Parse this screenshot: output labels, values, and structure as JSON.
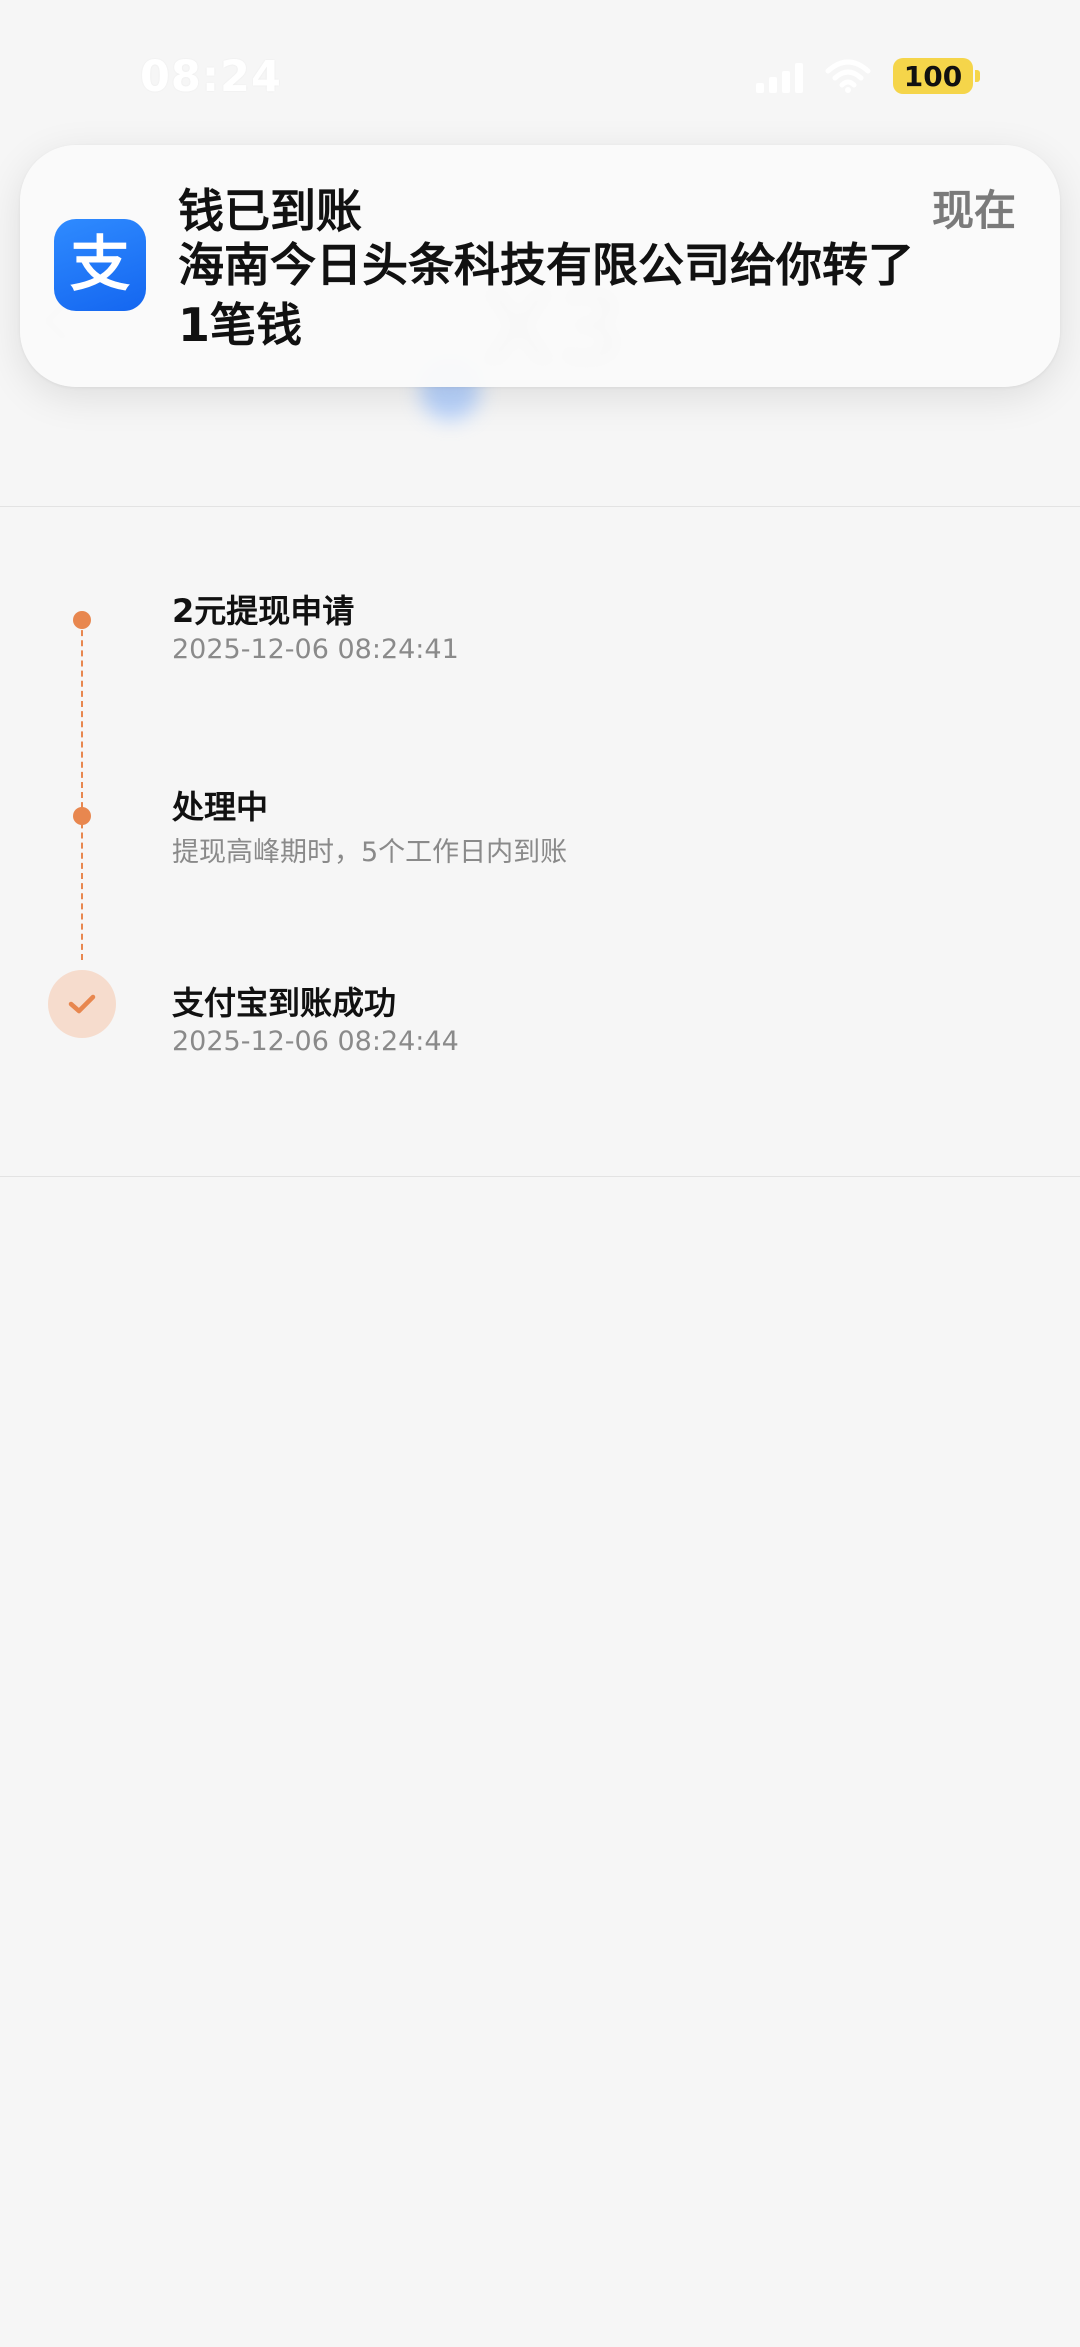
{
  "status_bar": {
    "time": "08:24",
    "battery": "100",
    "battery_color": "#f5d54a"
  },
  "background_blurred": {
    "amount_text": "X3"
  },
  "notification": {
    "app_icon": "alipay-icon",
    "app_icon_glyph": "支",
    "title": "钱已到账",
    "body": "海南今日头条科技有限公司给你转了1笔钱",
    "time": "现在"
  },
  "timeline": {
    "accent_color": "#e8874f",
    "steps": [
      {
        "title": "2元提现申请",
        "subtitle": "2025-12-06 08:24:41"
      },
      {
        "title": "处理中",
        "subtitle": "提现高峰期时，5个工作日内到账"
      },
      {
        "title": "支付宝到账成功",
        "subtitle": "2025-12-06 08:24:44"
      }
    ]
  }
}
